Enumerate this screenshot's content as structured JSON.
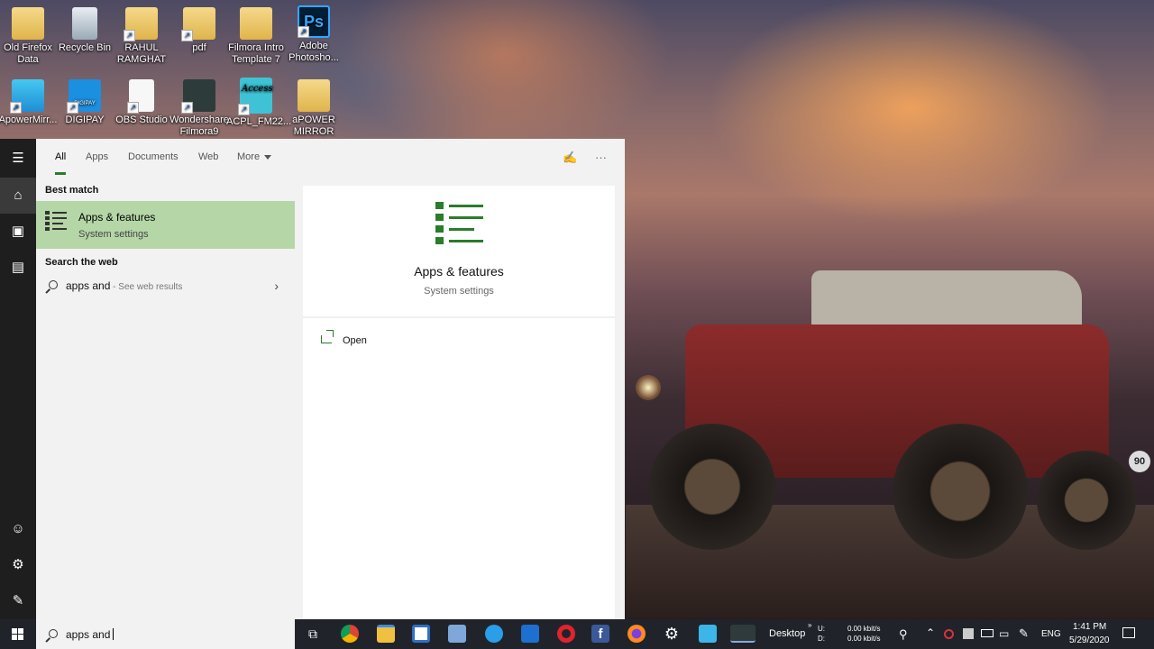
{
  "desktop": {
    "icons": [
      {
        "label": "Old Firefox Data",
        "icon": "folder-icon"
      },
      {
        "label": "Recycle Bin",
        "icon": "recycle-bin-icon"
      },
      {
        "label": "RAHUL RAMGHAT",
        "icon": "folder-icon"
      },
      {
        "label": "pdf",
        "icon": "folder-icon"
      },
      {
        "label": "Filmora Intro Template 7",
        "icon": "folder-icon"
      },
      {
        "label": "Adobe Photosho...",
        "icon": "photoshop-icon"
      },
      {
        "label": "ApowerMirr...",
        "icon": "apowermirror-icon"
      },
      {
        "label": "DIGIPAY",
        "icon": "digipay-icon"
      },
      {
        "label": "OBS Studio",
        "icon": "document-icon"
      },
      {
        "label": "Wondershare Filmora9",
        "icon": "filmora-icon"
      },
      {
        "label": "ACPL_FM22...",
        "icon": "access-icon"
      },
      {
        "label": "aPOWER MIRROR",
        "icon": "folder-icon"
      }
    ],
    "photoshop_glyph": "Ps",
    "digipay_caption": "DIGIPAY",
    "access_caption": "Access"
  },
  "search_panel": {
    "tabs": [
      "All",
      "Apps",
      "Documents",
      "Web",
      "More"
    ],
    "active_tab": "All",
    "best_match_heading": "Best match",
    "best_match": {
      "title": "Apps & features",
      "subtitle": "System settings"
    },
    "web_heading": "Search the web",
    "web_result": {
      "query": "apps and",
      "hint": " - See web results"
    },
    "preview": {
      "title": "Apps & features",
      "subtitle": "System settings"
    },
    "actions": [
      {
        "label": "Open"
      }
    ]
  },
  "taskbar": {
    "search_text": "apps and",
    "desktop_label": "Desktop",
    "net_upload_label": "U:",
    "net_download_label": "D:",
    "net_upload": "0.00 kbit/s",
    "net_download": "0.00 kbit/s",
    "language": "ENG",
    "time": "1:41 PM",
    "date": "5/29/2020"
  },
  "wallpaper": {
    "badge": "90"
  },
  "colors": {
    "accent": "#2a7d2a",
    "best_match_bg": "#b5d6a7",
    "taskbar": "#20242a"
  }
}
